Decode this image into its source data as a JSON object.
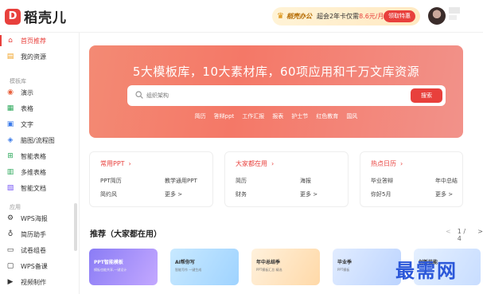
{
  "app": {
    "name": "稻壳儿",
    "logo_glyph": "D"
  },
  "promo": {
    "brand": "稻壳办公",
    "text": "超会2年卡仅需",
    "price": "8.6元/月",
    "button": "领取特惠"
  },
  "sidebar": {
    "items": [
      {
        "label": "首页推荐",
        "icon": "home-icon",
        "active": true
      },
      {
        "label": "我的资源",
        "icon": "folder-icon",
        "active": false
      }
    ],
    "section_templates": "模板库",
    "templates": [
      {
        "label": "演示",
        "icon": "presentation-icon"
      },
      {
        "label": "表格",
        "icon": "spreadsheet-icon"
      },
      {
        "label": "文字",
        "icon": "document-icon"
      },
      {
        "label": "脑图/流程图",
        "icon": "mindmap-icon"
      },
      {
        "label": "智能表格",
        "icon": "smart-table-icon"
      },
      {
        "label": "多维表格",
        "icon": "multi-table-icon"
      },
      {
        "label": "智能文档",
        "icon": "smart-doc-icon"
      }
    ],
    "section_apps": "应用",
    "apps": [
      {
        "label": "WPS海报",
        "icon": "poster-icon"
      },
      {
        "label": "简历助手",
        "icon": "resume-icon"
      },
      {
        "label": "试卷组卷",
        "icon": "exam-icon"
      },
      {
        "label": "WPS备课",
        "icon": "lesson-icon"
      },
      {
        "label": "视频制作",
        "icon": "video-icon"
      }
    ]
  },
  "banner": {
    "title": "5大模板库，10大素材库，60项应用和千万文库资源",
    "search_placeholder": "组织架构",
    "search_button": "搜索",
    "hot_tags": [
      "简历",
      "答辩ppt",
      "工作汇报",
      "报表",
      "护士节",
      "红色教育",
      "国风"
    ]
  },
  "cards": [
    {
      "title": "常用PPT",
      "links": [
        "PPT简历",
        "教学通用PPT",
        "简约风",
        "更多 >"
      ]
    },
    {
      "title": "大家都在用",
      "links": [
        "简历",
        "海报",
        "财务",
        "更多 >"
      ]
    },
    {
      "title": "热点日历",
      "links": [
        "毕业答辩",
        "年中总结",
        "你好5月",
        "更多 >"
      ]
    }
  ],
  "recommend": {
    "title": "推荐（大家都在用）",
    "page": "1 / 4",
    "prev": "<",
    "next": ">",
    "tiles": [
      {
        "label": "PPT智能模板",
        "sub": "模板也能共享,一键设计",
        "bg": "#dfe4ff",
        "color": "#fff"
      },
      {
        "label": "AI帮你写",
        "sub": "智能写作 一键生成",
        "bg": "#d9f1ff",
        "color": "#222"
      },
      {
        "label": "年中总结季",
        "sub": "PPT模板汇总 精选",
        "bg": "#fff1dc",
        "color": "#222"
      },
      {
        "label": "毕业季",
        "sub": "PPT模板",
        "bg": "#e1ecff",
        "color": "#222"
      },
      {
        "label": "创新技能",
        "sub": "",
        "bg": "#e5f0ff",
        "color": "#222"
      }
    ]
  },
  "watermark": "最需网",
  "colors": {
    "accent": "#e8403c",
    "banner_from": "#f38a74",
    "banner_to": "#f2928a"
  }
}
